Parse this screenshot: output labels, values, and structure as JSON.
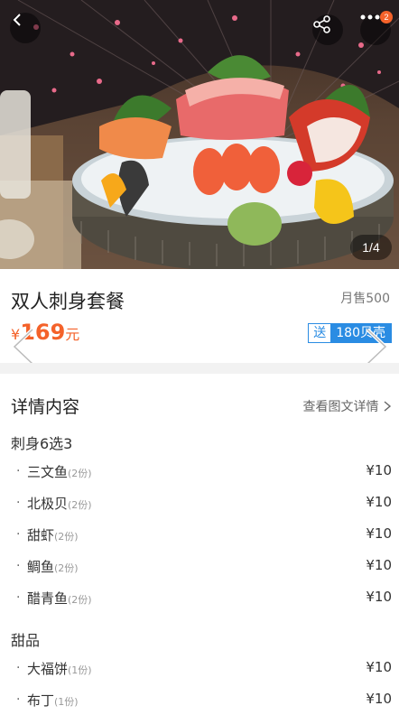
{
  "header": {
    "page_indicator": "1/4",
    "more_badge": "2"
  },
  "product": {
    "name": "双人刺身套餐",
    "monthly_sales": "月售500",
    "price_symbol": "¥",
    "price_value": "169",
    "price_unit": "元",
    "gift_label": "送",
    "gift_value": "180贝壳"
  },
  "details": {
    "title": "详情内容",
    "view_link": "查看图文详情",
    "groups": [
      {
        "title": "刺身6选3",
        "items": [
          {
            "name": "三文鱼",
            "qty": "(2份)",
            "price": "¥10"
          },
          {
            "name": "北极贝",
            "qty": "(2份)",
            "price": "¥10"
          },
          {
            "name": "甜虾",
            "qty": "(2份)",
            "price": "¥10"
          },
          {
            "name": "鲷鱼",
            "qty": "(2份)",
            "price": "¥10"
          },
          {
            "name": "醋青鱼",
            "qty": "(2份)",
            "price": "¥10"
          }
        ]
      },
      {
        "title": "甜品",
        "items": [
          {
            "name": "大福饼",
            "qty": "(1份)",
            "price": "¥10"
          },
          {
            "name": "布丁",
            "qty": "(1份)",
            "price": "¥10"
          }
        ]
      }
    ]
  },
  "colors": {
    "accent_orange": "#f4622a",
    "accent_blue": "#2a8ce3"
  }
}
